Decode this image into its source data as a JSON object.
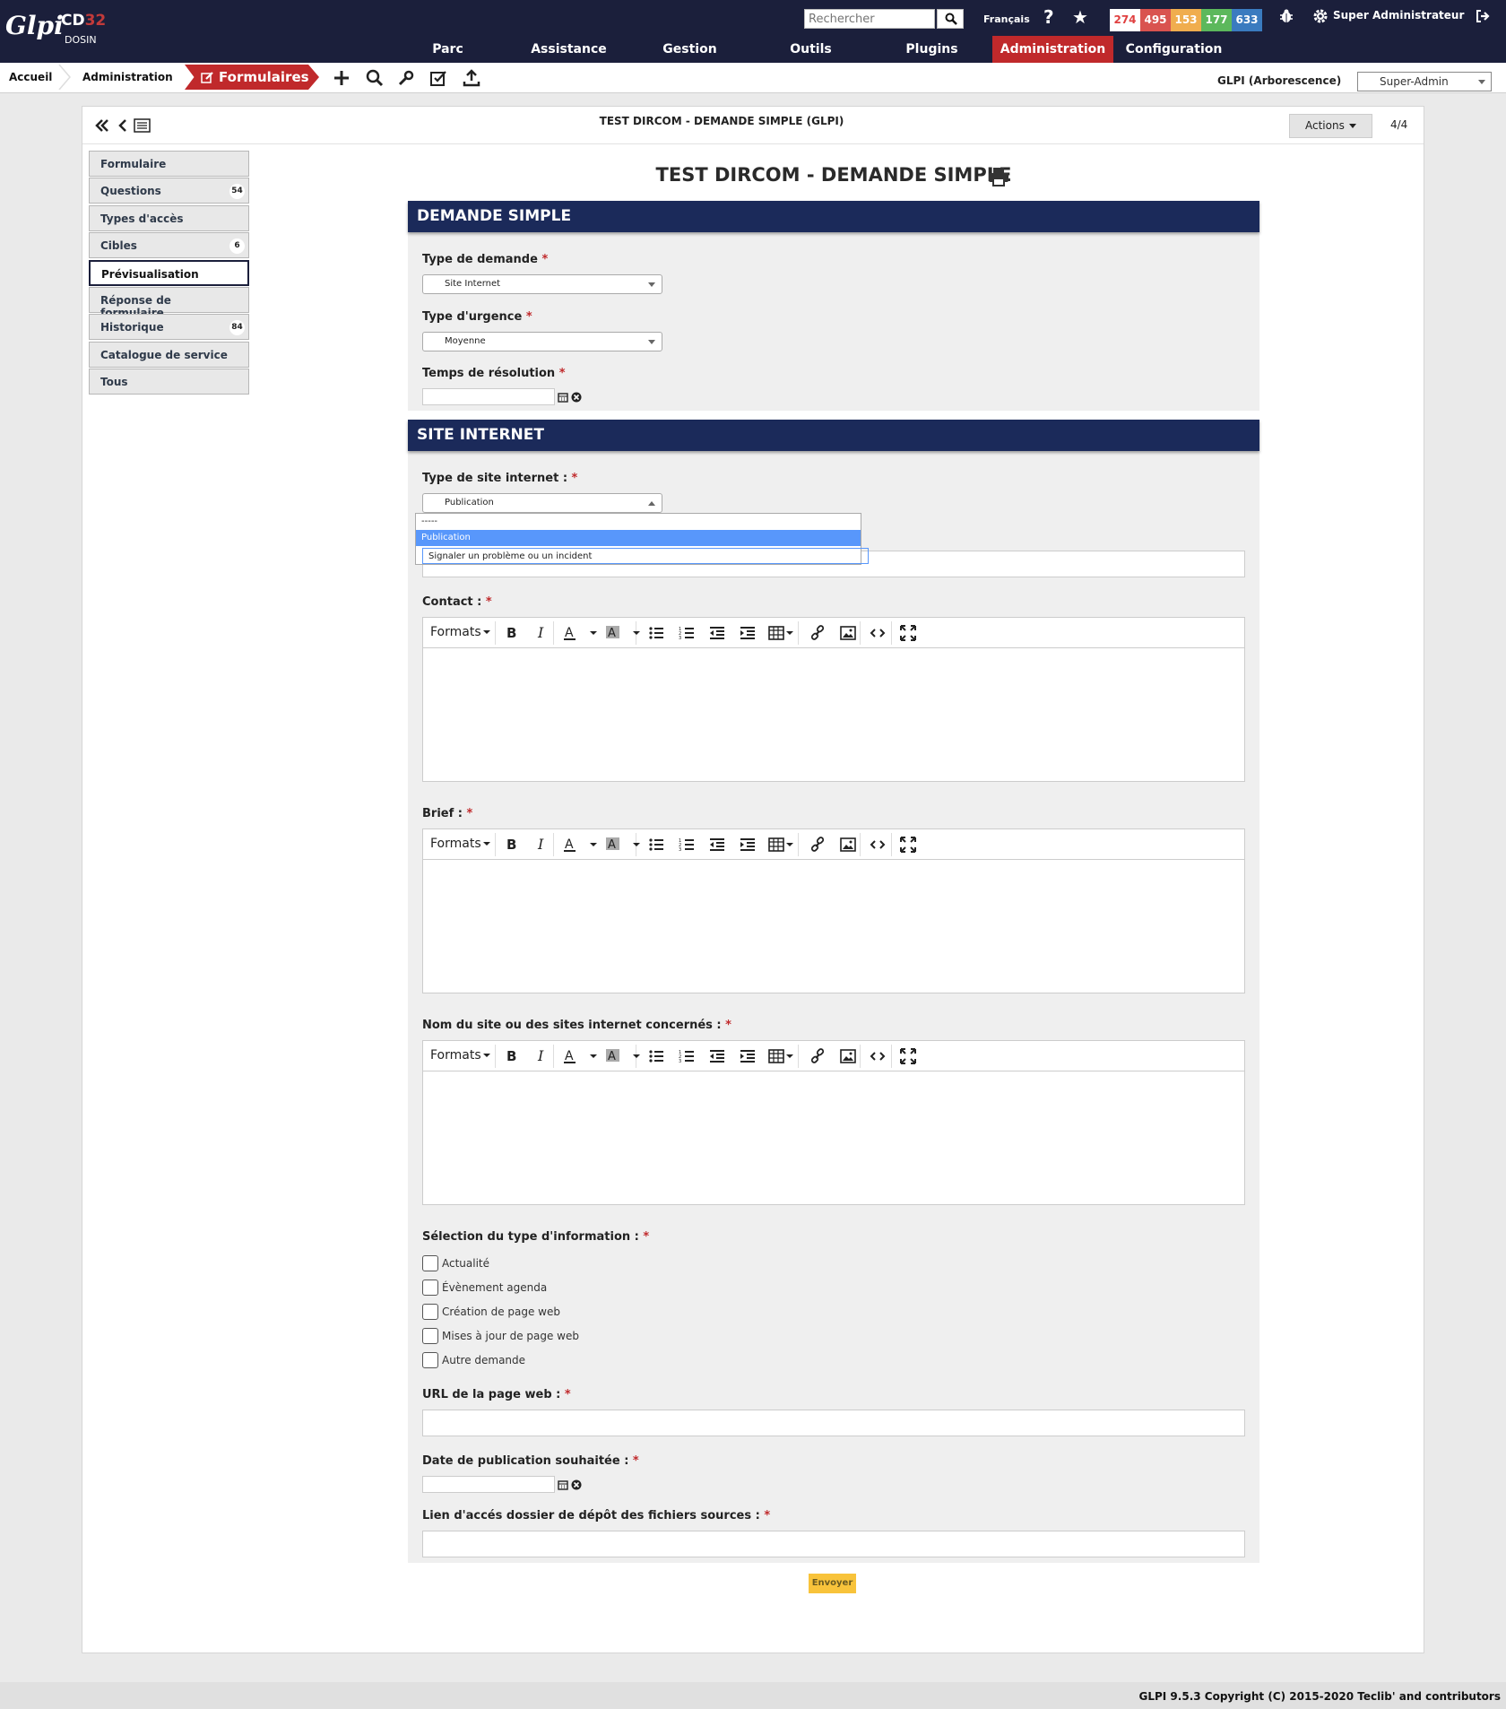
{
  "header": {
    "logo_text": "Glpi",
    "brand_main": "CD",
    "brand_accent": "32",
    "brand_sub": "DOSIN",
    "search_placeholder": "Rechercher",
    "language": "Français",
    "counters": [
      {
        "value": "274",
        "color": "#ffffff",
        "text_color": "#e04040"
      },
      {
        "value": "495",
        "color": "#d9534f",
        "text_color": "#ffffff"
      },
      {
        "value": "153",
        "color": "#f0ad4e",
        "text_color": "#ffffff"
      },
      {
        "value": "177",
        "color": "#5cb85c",
        "text_color": "#ffffff"
      },
      {
        "value": "633",
        "color": "#3a7bbf",
        "text_color": "#ffffff"
      }
    ],
    "user": "Super Administrateur"
  },
  "menu": [
    {
      "label": "Parc",
      "active": false
    },
    {
      "label": "Assistance",
      "active": false
    },
    {
      "label": "Gestion",
      "active": false
    },
    {
      "label": "Outils",
      "active": false
    },
    {
      "label": "Plugins",
      "active": false
    },
    {
      "label": "Administration",
      "active": true
    },
    {
      "label": "Configuration",
      "active": false
    }
  ],
  "breadcrumb": {
    "home": "Accueil",
    "section": "Administration",
    "current": "Formulaires"
  },
  "entity": "GLPI (Arborescence)",
  "profile": "Super-Admin",
  "page": {
    "title": "TEST DIRCOM - DEMANDE SIMPLE (GLPI)",
    "actions_label": "Actions",
    "pager": "4/4"
  },
  "tabs": [
    {
      "label": "Formulaire",
      "badge": ""
    },
    {
      "label": "Questions",
      "badge": "54"
    },
    {
      "label": "Types d'accès",
      "badge": ""
    },
    {
      "label": "Cibles",
      "badge": "6"
    },
    {
      "label": "Prévisualisation",
      "badge": "",
      "current": true
    },
    {
      "label": "Réponse de formulaire",
      "badge": ""
    },
    {
      "label": "Historique",
      "badge": "84"
    },
    {
      "label": "Catalogue de service",
      "badge": ""
    },
    {
      "label": "Tous",
      "badge": ""
    }
  ],
  "form": {
    "title": "TEST DIRCOM - DEMANDE SIMPLE",
    "sections": [
      {
        "title": "DEMANDE SIMPLE"
      },
      {
        "title": "SITE INTERNET"
      }
    ],
    "fields": {
      "type_demande": {
        "label": "Type de demande",
        "value": "Site Internet"
      },
      "type_urgence": {
        "label": "Type d'urgence",
        "value": "Moyenne"
      },
      "temps_resolution": {
        "label": "Temps de résolution"
      },
      "type_site": {
        "label": "Type de site internet :",
        "value": "Publication"
      },
      "contact": {
        "label": "Contact :"
      },
      "brief": {
        "label": "Brief :"
      },
      "nom_site": {
        "label": "Nom du site ou des sites internet concernés :"
      },
      "selection": {
        "label": "Sélection du type d'information :"
      },
      "url": {
        "label": "URL de la page web :"
      },
      "date_pub": {
        "label": "Date de publication souhaitée :"
      },
      "lien": {
        "label": "Lien d'accés dossier de dépôt des fichiers sources :"
      }
    },
    "dropdown_options": [
      "-----",
      "Publication",
      "Signaler un problème ou un incident"
    ],
    "checkboxes": [
      "Actualité",
      "Évènement agenda",
      "Création de page web",
      "Mises à jour de page web",
      "Autre demande"
    ],
    "editor_formats": "Formats",
    "submit_label": "Envoyer"
  },
  "footer": "GLPI 9.5.3 Copyright (C) 2015-2020 Teclib' and contributors"
}
